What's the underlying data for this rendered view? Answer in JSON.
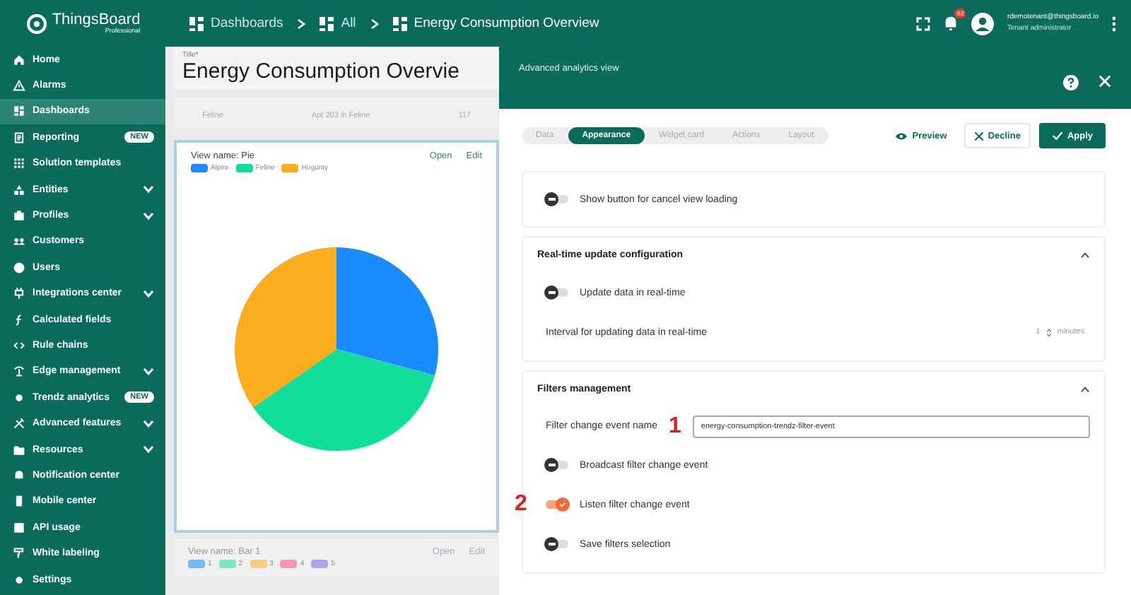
{
  "header": {
    "logo": {
      "name": "ThingsBoard",
      "edition": "Professional"
    },
    "breadcrumbs": [
      "Dashboards",
      "All",
      "Energy Consumption Overview"
    ],
    "notifications": "62",
    "user": {
      "email": "rdemotenant@thingsboard.io",
      "role": "Tenant administrator"
    }
  },
  "sidebar": {
    "items": [
      {
        "label": "Home",
        "selected": false,
        "expandable": false
      },
      {
        "label": "Alarms",
        "selected": false,
        "expandable": false
      },
      {
        "label": "Dashboards",
        "selected": true,
        "expandable": false
      },
      {
        "label": "Reporting",
        "selected": false,
        "expandable": false,
        "badge": "NEW"
      },
      {
        "label": "Solution templates",
        "selected": false,
        "expandable": false
      },
      {
        "label": "Entities",
        "selected": false,
        "expandable": true
      },
      {
        "label": "Profiles",
        "selected": false,
        "expandable": true
      },
      {
        "label": "Customers",
        "selected": false,
        "expandable": false
      },
      {
        "label": "Users",
        "selected": false,
        "expandable": false
      },
      {
        "label": "Integrations center",
        "selected": false,
        "expandable": true
      },
      {
        "label": "Calculated fields",
        "selected": false,
        "expandable": false
      },
      {
        "label": "Rule chains",
        "selected": false,
        "expandable": false
      },
      {
        "label": "Edge management",
        "selected": false,
        "expandable": true
      },
      {
        "label": "Trendz analytics",
        "selected": false,
        "expandable": false,
        "badge": "NEW"
      },
      {
        "label": "Advanced features",
        "selected": false,
        "expandable": true
      },
      {
        "label": "Resources",
        "selected": false,
        "expandable": true
      },
      {
        "label": "Notification center",
        "selected": false,
        "expandable": false
      },
      {
        "label": "Mobile center",
        "selected": false,
        "expandable": false
      },
      {
        "label": "API usage",
        "selected": false,
        "expandable": false
      },
      {
        "label": "White labeling",
        "selected": false,
        "expandable": false
      },
      {
        "label": "Settings",
        "selected": false,
        "expandable": false
      }
    ]
  },
  "dashboard": {
    "title_label": "Title*",
    "title": "Energy Consumption Overvie",
    "table_row": [
      "Feline",
      "Apt 203 in Feline",
      "117"
    ],
    "views": [
      {
        "name": "View name: Pie",
        "actions": [
          "Open",
          "Edit"
        ],
        "legend": [
          {
            "label": "Alpire",
            "color": "#1a8cff"
          },
          {
            "label": "Feline",
            "color": "#12dd99"
          },
          {
            "label": "Hogurity",
            "color": "#fcae1e"
          }
        ]
      },
      {
        "name": "View name: Bar 1",
        "actions": [
          "Open",
          "Edit"
        ],
        "legend": [
          {
            "label": "1",
            "color": "#7ab8f5"
          },
          {
            "label": "2",
            "color": "#7de3c0"
          },
          {
            "label": "3",
            "color": "#f9cd80"
          },
          {
            "label": "4",
            "color": "#f39aa8"
          },
          {
            "label": "5",
            "color": "#b3a4e6"
          }
        ]
      }
    ]
  },
  "panel": {
    "title": "Advanced analytics view",
    "tabs": [
      {
        "label": "Data",
        "selected": false
      },
      {
        "label": "Appearance",
        "selected": true
      },
      {
        "label": "Widget card",
        "selected": false
      },
      {
        "label": "Actions",
        "selected": false
      },
      {
        "label": "Layout",
        "selected": false
      }
    ],
    "buttons": [
      {
        "label": "Preview",
        "kind": "preview"
      },
      {
        "label": "Decline",
        "kind": "decline"
      },
      {
        "label": "Apply",
        "kind": "apply"
      }
    ],
    "top_toggle": {
      "label": "Show button for cancel view loading",
      "on": false
    },
    "sections": [
      {
        "title": "Real-time update configuration",
        "expanded": true,
        "rows": [
          {
            "kind": "toggle",
            "label": "Update data in real-time",
            "on": false
          },
          {
            "kind": "number",
            "label": "Interval for updating data in real-time",
            "value": "1",
            "unit": "minutes"
          }
        ]
      },
      {
        "title": "Filters management",
        "expanded": true,
        "rows": [
          {
            "kind": "text",
            "label": "Filter change event name",
            "value": "energy-consumption-trendz-filter-event",
            "marker": "1"
          },
          {
            "kind": "toggle",
            "label": "Broadcast filter change event",
            "on": false
          },
          {
            "kind": "toggle",
            "label": "Listen filter change event",
            "on": true,
            "marker": "2"
          },
          {
            "kind": "toggle",
            "label": "Save filters selection",
            "on": false
          }
        ]
      }
    ]
  }
}
